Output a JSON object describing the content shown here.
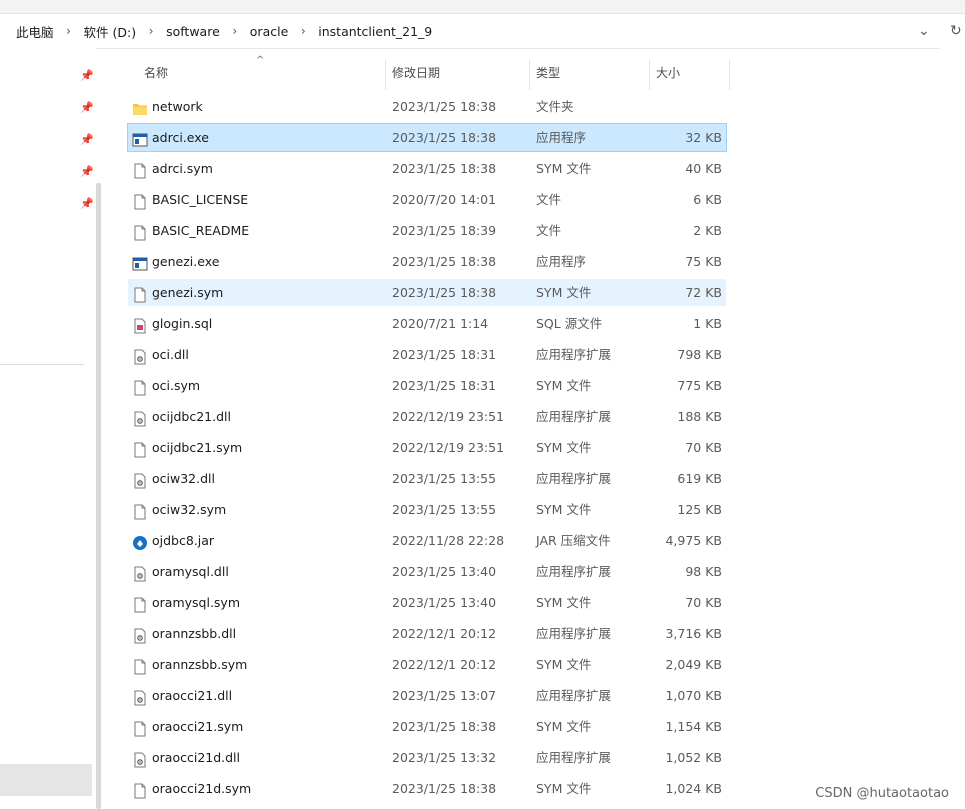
{
  "breadcrumb": [
    "此电脑",
    "软件 (D:)",
    "software",
    "oracle",
    "instantclient_21_9"
  ],
  "columns": {
    "name": "名称",
    "date": "修改日期",
    "type": "类型",
    "size": "大小"
  },
  "files": [
    {
      "name": "network",
      "date": "2023/1/25 18:38",
      "type": "文件夹",
      "size": "",
      "icon": "folder-icon",
      "state": ""
    },
    {
      "name": "adrci.exe",
      "date": "2023/1/25 18:38",
      "type": "应用程序",
      "size": "32 KB",
      "icon": "exe-icon",
      "state": "selected"
    },
    {
      "name": "adrci.sym",
      "date": "2023/1/25 18:38",
      "type": "SYM 文件",
      "size": "40 KB",
      "icon": "file-icon",
      "state": ""
    },
    {
      "name": "BASIC_LICENSE",
      "date": "2020/7/20 14:01",
      "type": "文件",
      "size": "6 KB",
      "icon": "file-icon",
      "state": ""
    },
    {
      "name": "BASIC_README",
      "date": "2023/1/25 18:39",
      "type": "文件",
      "size": "2 KB",
      "icon": "file-icon",
      "state": ""
    },
    {
      "name": "genezi.exe",
      "date": "2023/1/25 18:38",
      "type": "应用程序",
      "size": "75 KB",
      "icon": "exe-icon",
      "state": ""
    },
    {
      "name": "genezi.sym",
      "date": "2023/1/25 18:38",
      "type": "SYM 文件",
      "size": "72 KB",
      "icon": "file-icon",
      "state": "hover"
    },
    {
      "name": "glogin.sql",
      "date": "2020/7/21 1:14",
      "type": "SQL 源文件",
      "size": "1 KB",
      "icon": "sql-icon",
      "state": ""
    },
    {
      "name": "oci.dll",
      "date": "2023/1/25 18:31",
      "type": "应用程序扩展",
      "size": "798 KB",
      "icon": "dll-icon",
      "state": ""
    },
    {
      "name": "oci.sym",
      "date": "2023/1/25 18:31",
      "type": "SYM 文件",
      "size": "775 KB",
      "icon": "file-icon",
      "state": ""
    },
    {
      "name": "ocijdbc21.dll",
      "date": "2022/12/19 23:51",
      "type": "应用程序扩展",
      "size": "188 KB",
      "icon": "dll-icon",
      "state": ""
    },
    {
      "name": "ocijdbc21.sym",
      "date": "2022/12/19 23:51",
      "type": "SYM 文件",
      "size": "70 KB",
      "icon": "file-icon",
      "state": ""
    },
    {
      "name": "ociw32.dll",
      "date": "2023/1/25 13:55",
      "type": "应用程序扩展",
      "size": "619 KB",
      "icon": "dll-icon",
      "state": ""
    },
    {
      "name": "ociw32.sym",
      "date": "2023/1/25 13:55",
      "type": "SYM 文件",
      "size": "125 KB",
      "icon": "file-icon",
      "state": ""
    },
    {
      "name": "ojdbc8.jar",
      "date": "2022/11/28 22:28",
      "type": "JAR 压缩文件",
      "size": "4,975 KB",
      "icon": "jar-icon",
      "state": ""
    },
    {
      "name": "oramysql.dll",
      "date": "2023/1/25 13:40",
      "type": "应用程序扩展",
      "size": "98 KB",
      "icon": "dll-icon",
      "state": ""
    },
    {
      "name": "oramysql.sym",
      "date": "2023/1/25 13:40",
      "type": "SYM 文件",
      "size": "70 KB",
      "icon": "file-icon",
      "state": ""
    },
    {
      "name": "orannzsbb.dll",
      "date": "2022/12/1 20:12",
      "type": "应用程序扩展",
      "size": "3,716 KB",
      "icon": "dll-icon",
      "state": ""
    },
    {
      "name": "orannzsbb.sym",
      "date": "2022/12/1 20:12",
      "type": "SYM 文件",
      "size": "2,049 KB",
      "icon": "file-icon",
      "state": ""
    },
    {
      "name": "oraocci21.dll",
      "date": "2023/1/25 13:07",
      "type": "应用程序扩展",
      "size": "1,070 KB",
      "icon": "dll-icon",
      "state": ""
    },
    {
      "name": "oraocci21.sym",
      "date": "2023/1/25 18:38",
      "type": "SYM 文件",
      "size": "1,154 KB",
      "icon": "file-icon",
      "state": ""
    },
    {
      "name": "oraocci21d.dll",
      "date": "2023/1/25 13:32",
      "type": "应用程序扩展",
      "size": "1,052 KB",
      "icon": "dll-icon",
      "state": ""
    },
    {
      "name": "oraocci21d.sym",
      "date": "2023/1/25 18:38",
      "type": "SYM 文件",
      "size": "1,024 KB",
      "icon": "file-icon",
      "state": ""
    }
  ],
  "watermark": "CSDN @hutaotaotao",
  "colors": {
    "selected": "#cce8ff",
    "hover": "#e5f3ff",
    "folder": "#f8c84a",
    "exe": "#1e5fa8",
    "jar": "#1572c4",
    "sql": "#d3426b"
  }
}
